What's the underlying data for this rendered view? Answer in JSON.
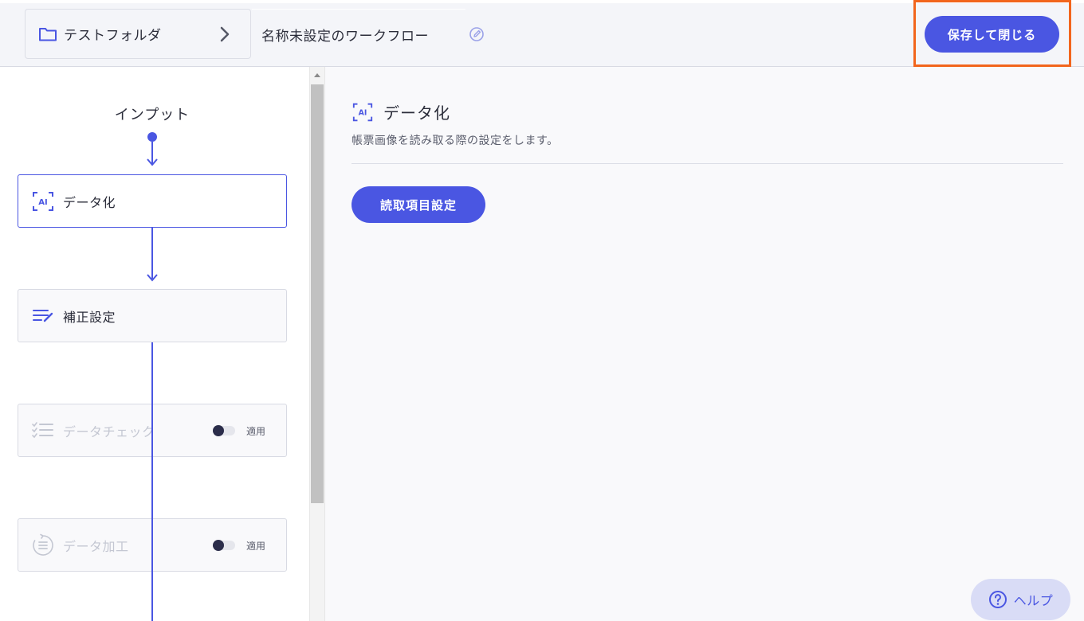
{
  "colors": {
    "accent": "#4a56e2",
    "highlight": "#f2651c",
    "disabled_text": "#c4c7d2",
    "header_bg": "#f4f5f9"
  },
  "header": {
    "breadcrumb": {
      "folder_icon": "folder-icon",
      "folder_label": "テストフォルダ",
      "separator_icon": "chevron-right-icon"
    },
    "workflow_title": "名称未設定のワークフロー",
    "edit_icon": "pencil-circle-icon",
    "save_close_label": "保存して閉じる"
  },
  "flow": {
    "input_label": "インプット",
    "steps": [
      {
        "label": "データ化",
        "icon": "ai-scan-icon",
        "state": "active"
      },
      {
        "label": "補正設定",
        "icon": "list-edit-icon",
        "state": "normal"
      },
      {
        "label": "データチェック",
        "icon": "checklist-icon",
        "state": "disabled",
        "toggle_on": false,
        "toggle_label": "適用"
      },
      {
        "label": "データ加工",
        "icon": "list-circle-icon",
        "state": "disabled",
        "toggle_on": false,
        "toggle_label": "適用"
      }
    ]
  },
  "detail": {
    "icon": "ai-scan-icon",
    "title": "データ化",
    "description": "帳票画像を読み取る際の設定をします。",
    "read_settings_label": "読取項目設定"
  },
  "help": {
    "icon": "question-circle-icon",
    "label": "ヘルプ"
  }
}
